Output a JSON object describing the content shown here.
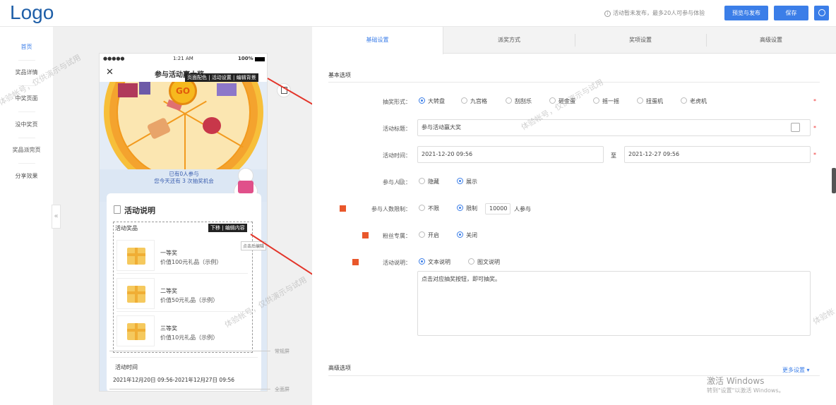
{
  "header": {
    "logo": "Logo",
    "notice": "活动暂未发布，最多20人可参与体验",
    "preview_publish": "预览与发布",
    "save": "保存"
  },
  "sidebar": {
    "items": [
      {
        "label": "首页",
        "active": true
      },
      {
        "label": "奖品详情"
      },
      {
        "label": "中奖页面"
      },
      {
        "label": "没中奖页"
      },
      {
        "label": "奖品派完页"
      },
      {
        "label": "分享效果"
      }
    ],
    "collapse": "«"
  },
  "phone": {
    "status_signal": "●●●●●",
    "status_time": "1:21 AM",
    "status_battery": "100%",
    "close": "✕",
    "title": "参与活动赢大奖",
    "toolbar": [
      "页面配色",
      "活动设置",
      "编辑背景"
    ],
    "go": "GO",
    "participants_line1": "已有0人参与",
    "participants_line2": "您今天还有 3 次抽奖机会",
    "desc_title": "活动说明",
    "prizes_label": "活动奖品",
    "prize_toolbar": [
      "下移",
      "编辑内容"
    ],
    "click_hint": "点击后编辑",
    "prizes": [
      {
        "name": "一等奖",
        "value": "价值100元礼品（示例）"
      },
      {
        "name": "二等奖",
        "value": "价值50元礼品（示例）"
      },
      {
        "name": "三等奖",
        "value": "价值10元礼品（示例）"
      }
    ],
    "time_label": "活动时间",
    "time_value": "2021年12月20日 09:56-2021年12月27日 09:56",
    "normal_screen": "常规屏",
    "full_screen": "全面屏"
  },
  "tabs": [
    {
      "label": "基础设置",
      "active": true
    },
    {
      "label": "派奖方式"
    },
    {
      "label": "奖项设置"
    },
    {
      "label": "高级设置"
    }
  ],
  "form": {
    "basic_section": "基本选项",
    "draw_form_label": "抽奖形式：",
    "draw_forms": [
      {
        "label": "大转盘",
        "checked": true
      },
      {
        "label": "九宫格"
      },
      {
        "label": "刮刮乐"
      },
      {
        "label": "砸金蛋"
      },
      {
        "label": "摇一摇"
      },
      {
        "label": "扭蛋机"
      },
      {
        "label": "老虎机"
      }
    ],
    "title_label": "活动标题：",
    "title_value": "参与活动赢大奖",
    "time_label": "活动时间：",
    "time_start": "2021-12-20 09:56",
    "time_to": "至",
    "time_end": "2021-12-27 09:56",
    "count_label": "参与人数：",
    "count_help": "?",
    "count_opts": [
      {
        "label": "隐藏"
      },
      {
        "label": "展示",
        "checked": true
      }
    ],
    "limit_label": "参与人数限制：",
    "limit_opts": [
      {
        "label": "不限"
      },
      {
        "label": "限制",
        "checked": true
      }
    ],
    "limit_value": "10000",
    "limit_suffix": "人参与",
    "fans_label": "粉丝专属：",
    "fans_opts": [
      {
        "label": "开启"
      },
      {
        "label": "关闭",
        "checked": true
      }
    ],
    "desc_label": "活动说明：",
    "desc_opts": [
      {
        "label": "文本说明",
        "checked": true
      },
      {
        "label": "图文说明"
      }
    ],
    "desc_text": "点击对应抽奖按钮，即可抽奖。",
    "required": "*",
    "advanced_section": "高级选项",
    "more_settings": "更多设置 ▾"
  },
  "watermark": "体验帐号，仅供演示与试用",
  "activation": {
    "line1": "激活 Windows",
    "line2": "转到\"设置\"以激活 Windows。"
  },
  "colors": {
    "accent": "#3b7ee8",
    "arrow": "#e3352a",
    "badge": "#e9572b"
  }
}
